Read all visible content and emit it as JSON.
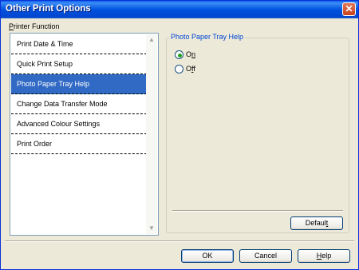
{
  "window": {
    "title": "Other Print Options"
  },
  "list_section": {
    "label": "Printer Function",
    "mnemonic": "P",
    "label_rest": "rinter Function"
  },
  "functions": [
    {
      "label": "Print Date & Time",
      "selected": false
    },
    {
      "label": "Quick Print Setup",
      "selected": false
    },
    {
      "label": "Photo Paper Tray Help",
      "selected": true
    },
    {
      "label": "Change Data Transfer Mode",
      "selected": false
    },
    {
      "label": "Advanced Colour Settings",
      "selected": false
    },
    {
      "label": "Print Order",
      "selected": false
    }
  ],
  "group": {
    "title": "Photo Paper Tray Help"
  },
  "options": {
    "on": {
      "label": "On",
      "mnemonic": "n",
      "before": "O",
      "after": "",
      "checked": true
    },
    "off": {
      "label": "Off",
      "mnemonic": "f",
      "before": "O",
      "after": "f",
      "checked": false
    }
  },
  "buttons": {
    "default": {
      "label": "Default",
      "before": "Defaul",
      "mnemonic": "t",
      "after": ""
    },
    "ok": {
      "label": "OK"
    },
    "cancel": {
      "label": "Cancel"
    },
    "help": {
      "label": "Help",
      "before": "",
      "mnemonic": "H",
      "after": "elp"
    }
  },
  "icons": {
    "close": "close-icon",
    "scroll_up": "scroll-up-icon",
    "scroll_down": "scroll-down-icon"
  },
  "colors": {
    "titlebar": "#0052E0",
    "selection": "#316AC5",
    "group_title": "#0046D5",
    "dialog_bg": "#ECE9D8"
  }
}
